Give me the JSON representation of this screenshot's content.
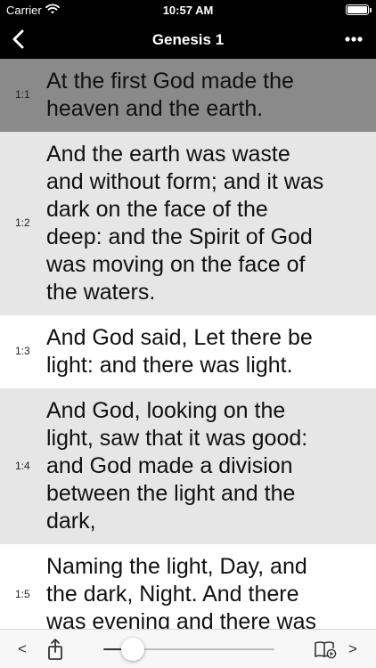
{
  "status_bar": {
    "carrier": "Carrier",
    "time": "10:57 AM",
    "icons": [
      "wifi-icon",
      "battery-icon"
    ]
  },
  "nav": {
    "title": "Genesis 1",
    "back_icon": "chevron-left-icon",
    "more_icon": "ellipsis-icon"
  },
  "colors": {
    "bar_background": "#000000",
    "selected_verse": "#8a8a8a",
    "alternate_verse": "#e6e6e6",
    "verse_background": "#ffffff",
    "toolbar_background": "#f7f7f7"
  },
  "verses": [
    {
      "number": "1:1",
      "state": "selected",
      "lines": [
        "At the first God made the",
        "heaven and the earth."
      ]
    },
    {
      "number": "1:2",
      "state": "alternate",
      "lines": [
        "And the earth was waste",
        "and without form; and it was",
        "dark on the face of the",
        "deep: and the Spirit of God",
        "was moving on the face of",
        "the waters."
      ]
    },
    {
      "number": "1:3",
      "state": "normal",
      "lines": [
        "And God said, Let there be",
        "light: and there was light."
      ]
    },
    {
      "number": "1:4",
      "state": "alternate",
      "lines": [
        "And God, looking on the",
        "light, saw that it was good:",
        "and God made a division",
        "between the light and the",
        "dark,"
      ]
    },
    {
      "number": "1:5",
      "state": "normal",
      "lines": [
        "Naming the light, Day, and",
        "the dark, Night. And there",
        "was evening and there was"
      ]
    }
  ],
  "toolbar": {
    "prev_label": "<",
    "next_label": ">",
    "share_icon": "share-icon",
    "read_aloud_icon": "book-play-icon",
    "slider_level": 0.17
  }
}
